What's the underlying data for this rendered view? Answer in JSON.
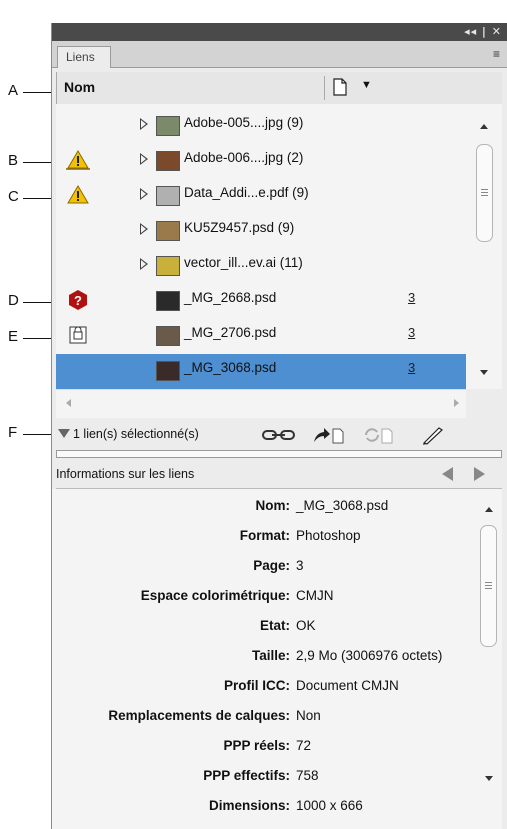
{
  "panel": {
    "tab_label": "Liens",
    "titlebar_controls": "◂◂ | ✕",
    "menu_icon": "≡"
  },
  "column_header": {
    "name_label": "Nom"
  },
  "callouts": [
    "A",
    "B",
    "C",
    "D",
    "E",
    "F"
  ],
  "links": [
    {
      "name": "Adobe-005....jpg (9)",
      "expandable": true,
      "status": "",
      "page": "",
      "selected": false,
      "thumb_color": "#7a8a6a"
    },
    {
      "name": "Adobe-006....jpg (2)",
      "expandable": true,
      "status": "warning-multi-icon",
      "page": "",
      "selected": false,
      "thumb_color": "#7a4a2a"
    },
    {
      "name": "Data_Addi...e.pdf (9)",
      "expandable": true,
      "status": "warning-icon",
      "page": "",
      "selected": false,
      "thumb_color": "#b0b0b0"
    },
    {
      "name": "KU5Z9457.psd (9)",
      "expandable": true,
      "status": "",
      "page": "",
      "selected": false,
      "thumb_color": "#9a7a4a"
    },
    {
      "name": "vector_ill...ev.ai (11)",
      "expandable": true,
      "status": "",
      "page": "",
      "selected": false,
      "thumb_color": "#c9b03a"
    },
    {
      "name": "_MG_2668.psd",
      "expandable": false,
      "status": "missing-icon",
      "page": "3",
      "selected": false,
      "thumb_color": "#2a2a2a"
    },
    {
      "name": "_MG_2706.psd",
      "expandable": false,
      "status": "embedded-icon",
      "page": "3",
      "selected": false,
      "thumb_color": "#6a5a4a"
    },
    {
      "name": "_MG_3068.psd",
      "expandable": false,
      "status": "",
      "page": "3",
      "selected": true,
      "thumb_color": "#3a2a2a"
    }
  ],
  "status_bar": {
    "selection_text": "1 lien(s) sélectionné(s)",
    "tools": [
      "relink-icon",
      "goto-link-icon",
      "update-link-icon",
      "edit-original-icon"
    ]
  },
  "info": {
    "title": "Informations sur les liens",
    "rows": [
      {
        "label": "Nom:",
        "value": "_MG_3068.psd"
      },
      {
        "label": "Format:",
        "value": "Photoshop"
      },
      {
        "label": "Page:",
        "value": "3"
      },
      {
        "label": "Espace colorimétrique:",
        "value": "CMJN"
      },
      {
        "label": "Etat:",
        "value": "OK"
      },
      {
        "label": "Taille:",
        "value": "2,9 Mo  (3006976 octets)"
      },
      {
        "label": "Profil ICC:",
        "value": "Document CMJN"
      },
      {
        "label": "Remplacements de calques:",
        "value": "Non"
      },
      {
        "label": "PPP réels:",
        "value": "72"
      },
      {
        "label": "PPP effectifs:",
        "value": "758"
      },
      {
        "label": "Dimensions:",
        "value": "1000 x 666"
      }
    ]
  },
  "colors": {
    "selection": "#4d8fd1",
    "warning": "#f2c200",
    "missing": "#b01010"
  }
}
